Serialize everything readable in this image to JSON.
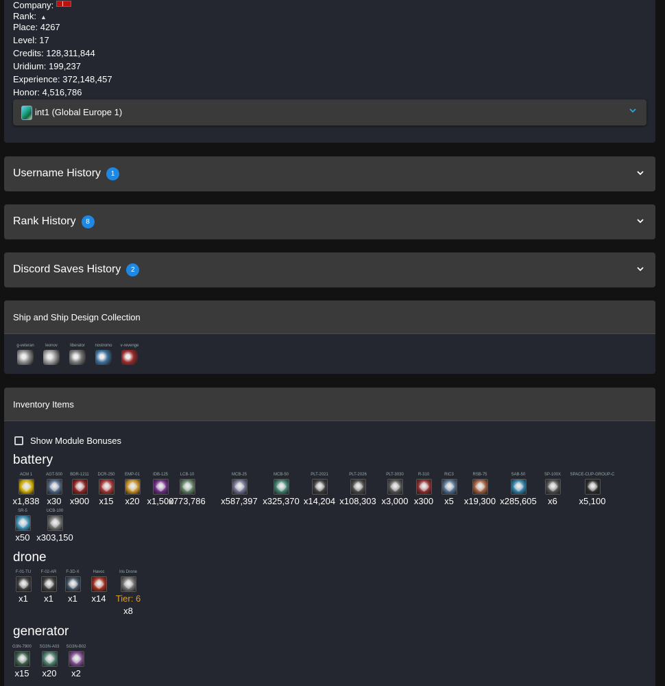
{
  "profile": {
    "company_label": "Company:",
    "rank_label": "Rank:",
    "place": "Place: 4267",
    "level": "Level: 17",
    "credits": "Credits: 128,311,844",
    "uridium": "Uridium: 199,237",
    "experience": "Experience: 372,148,457",
    "honor": "Honor: 4,516,786",
    "server": "int1 (Global Europe 1)"
  },
  "accordions": [
    {
      "title": "Username History",
      "count": "1"
    },
    {
      "title": "Rank History",
      "count": "8"
    },
    {
      "title": "Discord Saves History",
      "count": "2"
    }
  ],
  "ships": {
    "title": "Ship and Ship Design Collection",
    "items": [
      {
        "name": "g-veteran",
        "color": "#8a8a8a"
      },
      {
        "name": "leonov",
        "color": "#9a9a9a"
      },
      {
        "name": "liberator",
        "color": "#777777"
      },
      {
        "name": "nostromo",
        "color": "#3b6f9a"
      },
      {
        "name": "v-revenge",
        "color": "#9a2a2a"
      }
    ]
  },
  "inventory": {
    "title": "Inventory Items",
    "show_bonuses_label": "Show Module Bonuses",
    "categories": [
      {
        "name": "battery"
      },
      {
        "name": "drone"
      },
      {
        "name": "generator"
      }
    ],
    "battery": [
      {
        "name": "ACM 1",
        "qty": "x1,838",
        "color": "#c8a800"
      },
      {
        "name": "AGT-500",
        "qty": "x30",
        "color": "#4a6080"
      },
      {
        "name": "BDR-1211",
        "qty": "x900",
        "color": "#8a2020"
      },
      {
        "name": "DCR-250",
        "qty": "x15",
        "color": "#a03030"
      },
      {
        "name": "EMP-01",
        "qty": "x20",
        "color": "#c08a20"
      },
      {
        "name": "IDB-125",
        "qty": "x1,500",
        "color": "#6a2a80"
      },
      {
        "name": "LCB-10",
        "qty": "x773,786",
        "color": "#5a7a60"
      },
      {
        "name": "MCB-25",
        "qty": "x587,397",
        "color": "#6a6a8a"
      },
      {
        "name": "MCB-50",
        "qty": "x325,370",
        "color": "#3a7a6a"
      },
      {
        "name": "PLT-2021",
        "qty": "x14,204",
        "color": "#3a3a3a"
      },
      {
        "name": "PLT-2026",
        "qty": "x108,303",
        "color": "#444444"
      },
      {
        "name": "PLT-3030",
        "qty": "x3,000",
        "color": "#505050"
      },
      {
        "name": "R-310",
        "qty": "x300",
        "color": "#8a2a2a"
      },
      {
        "name": "RIC3",
        "qty": "x5",
        "color": "#4a6a8a"
      },
      {
        "name": "RSB-75",
        "qty": "x19,300",
        "color": "#9a5a3a"
      },
      {
        "name": "SAB-50",
        "qty": "x285,605",
        "color": "#2a7aa0"
      },
      {
        "name": "SP-100X",
        "qty": "x6",
        "color": "#4a4a4a"
      },
      {
        "name": "SPACE-CUP-GROUP-C",
        "qty": "x5,100",
        "color": "#2a2a2a"
      },
      {
        "name": "SR-5",
        "qty": "x50",
        "color": "#3a8ab0"
      },
      {
        "name": "UCB-100",
        "qty": "x303,150",
        "color": "#6a6a6a"
      }
    ],
    "drone": [
      {
        "name": "F-01-TU",
        "qty": "x1",
        "color": "#3a3a3a"
      },
      {
        "name": "F-02-AR",
        "qty": "x1",
        "color": "#3a3a3a"
      },
      {
        "name": "F-3D-X",
        "qty": "x1",
        "color": "#3a4a5a"
      },
      {
        "name": "Havoc",
        "qty": "x14",
        "color": "#9a2a1a"
      },
      {
        "name": "Iris Drone",
        "tier": "Tier: 6",
        "qty": "x8",
        "color": "#6a6a6a"
      }
    ],
    "generator": [
      {
        "name": "G3N-7900",
        "qty": "x15",
        "color": "#3a5a4a"
      },
      {
        "name": "SG3N-A03",
        "qty": "x20",
        "color": "#4a7a6a"
      },
      {
        "name": "SG3N-B02",
        "qty": "x2",
        "color": "#7a4a8a"
      }
    ]
  }
}
